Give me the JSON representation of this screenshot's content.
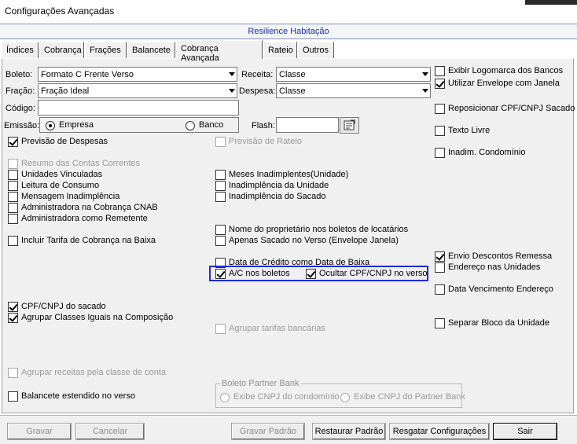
{
  "window": {
    "title": "Configurações Avançadas"
  },
  "header": {
    "title": "Resilience Habitação"
  },
  "tabs": [
    {
      "label": "Índices"
    },
    {
      "label": "Cobrança"
    },
    {
      "label": "Frações"
    },
    {
      "label": "Balancete"
    },
    {
      "label": "Cobrança Avançada",
      "active": true
    },
    {
      "label": "Rateio"
    },
    {
      "label": "Outros"
    }
  ],
  "form": {
    "boleto_label": "Boleto:",
    "boleto_value": "Formato C Frente Verso",
    "fracao_label": "Fração:",
    "fracao_value": "Fração Ideal",
    "receita_label": "Receita:",
    "receita_value": "Classe",
    "despesa_label": "Despesa:",
    "despesa_value": "Classe",
    "codigo_label": "Código:",
    "codigo_value": "",
    "emissao_label": "Emissão:",
    "emissao_option1": "Empresa",
    "emissao_option2": "Banco",
    "emissao_selected": "Empresa",
    "flash_label": "Flash:",
    "flash_value": ""
  },
  "checkboxes": {
    "exibir_logomarca": {
      "label": "Exibir Logomarca dos Bancos",
      "checked": false
    },
    "utilizar_envelope": {
      "label": "Utilizar Envelope com Janela",
      "checked": true
    },
    "reposicionar_cpf": {
      "label": "Reposicionar CPF/CNPJ Sacado",
      "checked": false
    },
    "texto_livre": {
      "label": "Texto Livre",
      "checked": false
    },
    "inadim_condominio": {
      "label": "Inadim. Condomínio",
      "checked": false
    },
    "previsao_despesas": {
      "label": "Previsão de Despesas",
      "checked": true
    },
    "previsao_rateio": {
      "label": "Previsão de Rateio",
      "checked": false,
      "disabled": true
    },
    "resumo_contas": {
      "label": "Resumo das Contas Correntes",
      "checked": false,
      "disabled": true
    },
    "unidades_vinculadas": {
      "label": "Unidades Vinculadas",
      "checked": false
    },
    "leitura_consumo": {
      "label": "Leitura de Consumo",
      "checked": false
    },
    "mensagem_inadimplencia": {
      "label": "Mensagem Inadimplência",
      "checked": false
    },
    "admin_cobranca_cnab": {
      "label": "Administradora na Cobrança CNAB",
      "checked": false
    },
    "admin_remetente": {
      "label": "Administradora como Remetente",
      "checked": false
    },
    "meses_inadimplentes": {
      "label": "Meses Inadimplentes(Unidade)",
      "checked": false
    },
    "inadimplencia_unidade": {
      "label": "Inadimplência da Unidade",
      "checked": false
    },
    "inadimplencia_sacado": {
      "label": "Inadimplência do Sacado",
      "checked": false
    },
    "nome_proprietario": {
      "label": "Nome do proprietário nos boletos de locatários",
      "checked": false
    },
    "apenas_sacado": {
      "label": "Apenas Sacado no Verso (Envelope Janela)",
      "checked": false
    },
    "incluir_tarifa": {
      "label": "Incluir Tarifa de Cobrança na Baixa",
      "checked": false
    },
    "data_credito": {
      "label": "Data de Crédito como Data de Baixa",
      "checked": false
    },
    "ac_boletos": {
      "label": "A/C nos boletos",
      "checked": true
    },
    "ocultar_cpf": {
      "label": "Ocultar CPF/CNPJ no verso",
      "checked": true
    },
    "envio_descontos": {
      "label": "Envio Descontos Remessa",
      "checked": true
    },
    "endereco_unidades": {
      "label": "Endereço nas Unidades",
      "checked": false
    },
    "data_vencimento": {
      "label": "Data Vencimento Endereço",
      "checked": false
    },
    "cpf_sacado": {
      "label": "CPF/CNPJ do sacado",
      "checked": true
    },
    "agrupar_classes": {
      "label": "Agrupar Classes Iguais na Composição",
      "checked": true
    },
    "agrupar_tarifas": {
      "label": "Agrupar tarifas bancárias",
      "checked": false,
      "disabled": true
    },
    "separar_bloco": {
      "label": "Separar Bloco da Unidade",
      "checked": false
    },
    "agrupar_receitas": {
      "label": "Agrupar receitas pela classe de conta",
      "checked": false,
      "disabled": true
    },
    "balancete_estendido": {
      "label": "Balancete estendido no verso",
      "checked": false
    }
  },
  "partner_bank": {
    "title": "Boleto Partner Bank",
    "option1": "Exibe CNPJ do condomínio",
    "option2": "Exibe CNPJ do Partner Bank"
  },
  "buttons": {
    "gravar": "Gravar",
    "cancelar": "Cancelar",
    "gravar_padrao": "Gravar Padrão",
    "restaurar_padrao": "Restaurar Padrão",
    "resgatar": "Resgatar Configurações",
    "sair": "Sair"
  }
}
